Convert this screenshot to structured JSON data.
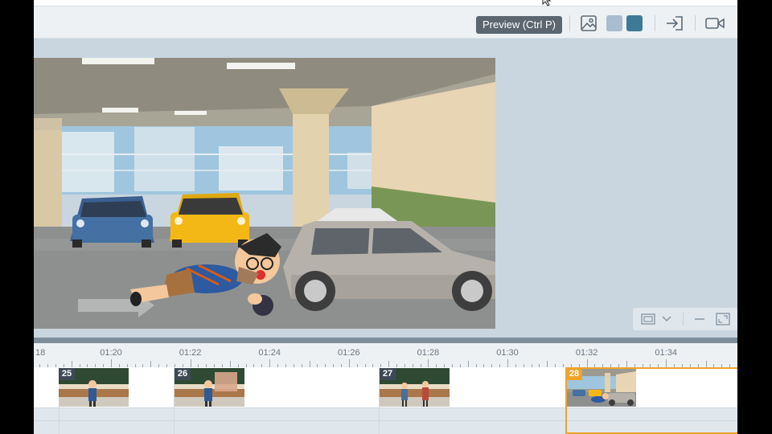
{
  "toolbar": {
    "tooltip": "Preview (Ctrl P)",
    "icons": [
      "preview-icon",
      "image-icon",
      "swatch-light",
      "swatch-dark",
      "enter-icon",
      "camera-icon"
    ],
    "swatch_light": "#a9bcd0",
    "swatch_dark": "#3d7a96"
  },
  "timeline": {
    "ticks": [
      "01:20",
      "01:22",
      "01:24",
      "01:26",
      "01:28",
      "01:30",
      "01:32",
      "01:34"
    ],
    "edge_label": "18",
    "scenes": [
      {
        "number": "25"
      },
      {
        "number": "26"
      },
      {
        "number": "27"
      },
      {
        "number": "28"
      }
    ],
    "selected_scene": "28",
    "accent": "#f0a32a"
  },
  "zoom": {
    "icons": [
      "frame-icon",
      "chevron-down-icon",
      "minus-icon",
      "expand-icon"
    ]
  }
}
